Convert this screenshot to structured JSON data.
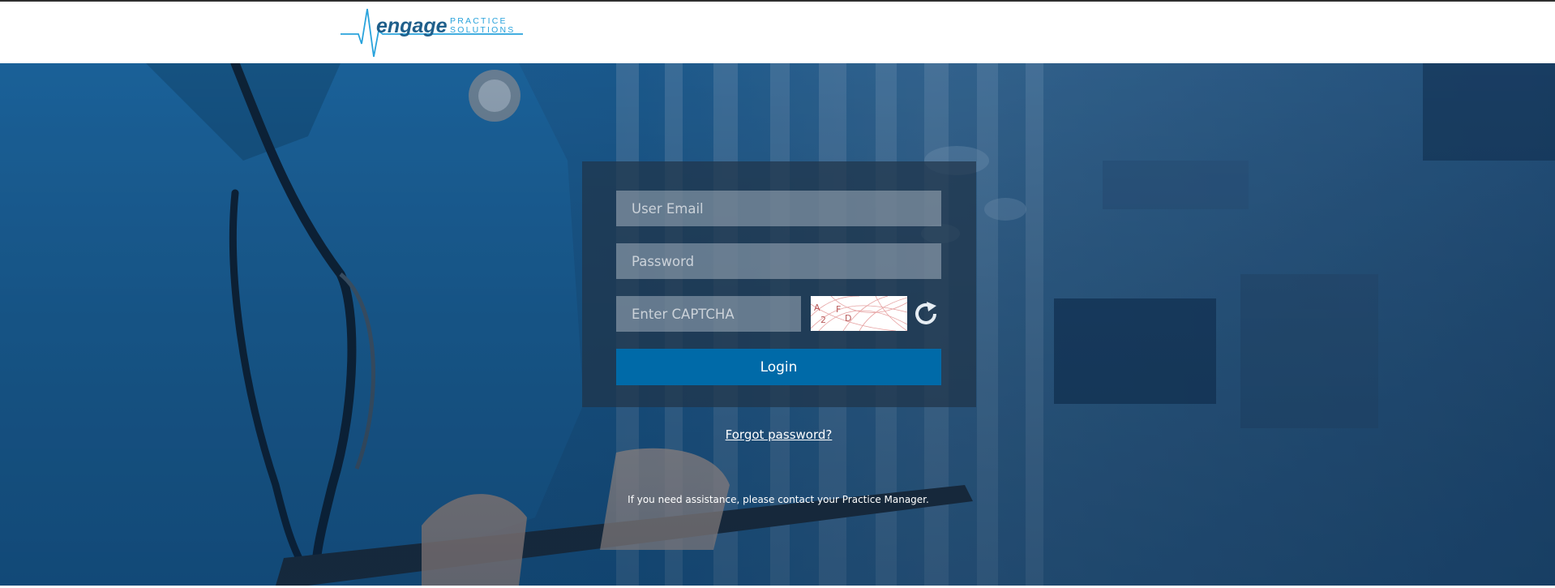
{
  "brand": {
    "name": "engage",
    "sub_line1": "PRACTICE",
    "sub_line2": "SOLUTIONS"
  },
  "login": {
    "email_placeholder": "User Email",
    "password_placeholder": "Password",
    "captcha_placeholder": "Enter CAPTCHA",
    "captcha_text": [
      "A",
      "2",
      "F",
      "D"
    ],
    "login_label": "Login",
    "forgot_label": "Forgot password?"
  },
  "footer": {
    "assistance_text": "If you need assistance, please contact your Practice Manager."
  },
  "colors": {
    "brand_blue": "#006aa8",
    "logo_dark": "#1f5f8b",
    "logo_light": "#29a3dc",
    "overlay": "#20344a"
  },
  "icons": {
    "refresh": "refresh-icon",
    "logo": "engage-logo"
  }
}
